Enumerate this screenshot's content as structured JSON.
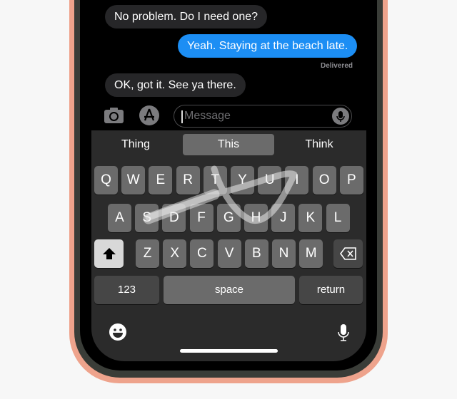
{
  "messages": [
    {
      "text": "No problem. Do I need one?",
      "direction": "incoming"
    },
    {
      "text": "Yeah. Staying at the beach late.",
      "direction": "outgoing"
    },
    {
      "text": "OK, got it. See ya there.",
      "direction": "incoming"
    }
  ],
  "status": "Delivered",
  "input": {
    "placeholder": "Message",
    "camera_icon": "camera-icon",
    "apps_icon": "app-store-icon",
    "mic_icon": "microphone-icon"
  },
  "suggestions": [
    "Thing",
    "This",
    "Think"
  ],
  "keyboard": {
    "row1": [
      "Q",
      "W",
      "E",
      "R",
      "T",
      "Y",
      "U",
      "I",
      "O",
      "P"
    ],
    "row2": [
      "A",
      "S",
      "D",
      "F",
      "G",
      "H",
      "J",
      "K",
      "L"
    ],
    "row3": [
      "Z",
      "X",
      "C",
      "V",
      "B",
      "N",
      "M"
    ],
    "numbers": "123",
    "space": "space",
    "return": "return",
    "shift_icon": "shift-icon",
    "delete_icon": "delete-icon",
    "emoji_icon": "emoji-icon",
    "dictation_icon": "microphone-icon"
  },
  "colors": {
    "outgoing_bubble": "#1c8ef4",
    "incoming_bubble": "#262628",
    "frame": "#eea38c"
  }
}
